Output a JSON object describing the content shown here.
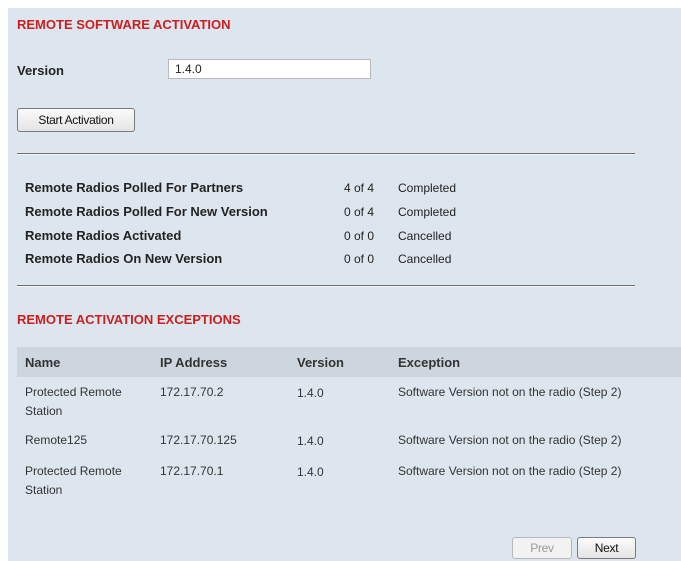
{
  "activation": {
    "title": "REMOTE SOFTWARE ACTIVATION",
    "version_label": "Version",
    "version_value": "1.4.0",
    "start_button": "Start Activation"
  },
  "stats": [
    {
      "label": "Remote Radios Polled For Partners",
      "count": "4 of 4",
      "status": "Completed"
    },
    {
      "label": "Remote Radios Polled For New Version",
      "count": "0 of 4",
      "status": "Completed"
    },
    {
      "label": "Remote Radios Activated",
      "count": "0 of 0",
      "status": "Cancelled"
    },
    {
      "label": "Remote Radios On New Version",
      "count": "0 of 0",
      "status": "Cancelled"
    }
  ],
  "exceptions": {
    "title": "REMOTE ACTIVATION EXCEPTIONS",
    "columns": [
      "Name",
      "IP Address",
      "Version",
      "Exception"
    ],
    "rows": [
      {
        "name": "Protected Remote Station",
        "ip": "172.17.70.2",
        "version": "1.4.0",
        "exception": "Software Version not on the radio (Step 2)"
      },
      {
        "name": "Remote125",
        "ip": "172.17.70.125",
        "version": "1.4.0",
        "exception": "Software Version not on the radio (Step 2)"
      },
      {
        "name": "Protected Remote Station",
        "ip": "172.17.70.1",
        "version": "1.4.0",
        "exception": "Software Version not on the radio (Step 2)"
      }
    ]
  },
  "pagination": {
    "prev": "Prev",
    "next": "Next"
  },
  "colors": {
    "heading": "#cc1e1e",
    "panel": "#dde6ee",
    "header_row": "#cdd6de"
  }
}
